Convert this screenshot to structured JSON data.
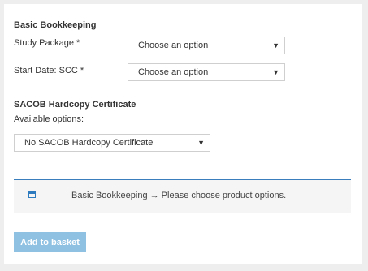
{
  "product": {
    "title": "Basic Bookkeeping"
  },
  "fields": {
    "study_package": {
      "label": "Study Package *",
      "value": "Choose an option"
    },
    "start_date": {
      "label": "Start Date: SCC *",
      "value": "Choose an option"
    }
  },
  "certificate": {
    "title": "SACOB Hardcopy Certificate",
    "available_label": "Available options:",
    "value": "No SACOB Hardcopy Certificate"
  },
  "notice": {
    "icon": "calendar-icon",
    "text": "Basic Bookkeeping → Please choose product options."
  },
  "actions": {
    "add_to_basket": "Add to basket"
  },
  "colors": {
    "accent": "#3a7ebd",
    "button_bg": "#8fc1e3",
    "page_bg": "#eeeeee"
  },
  "icons": {
    "select_arrow": "▼"
  }
}
